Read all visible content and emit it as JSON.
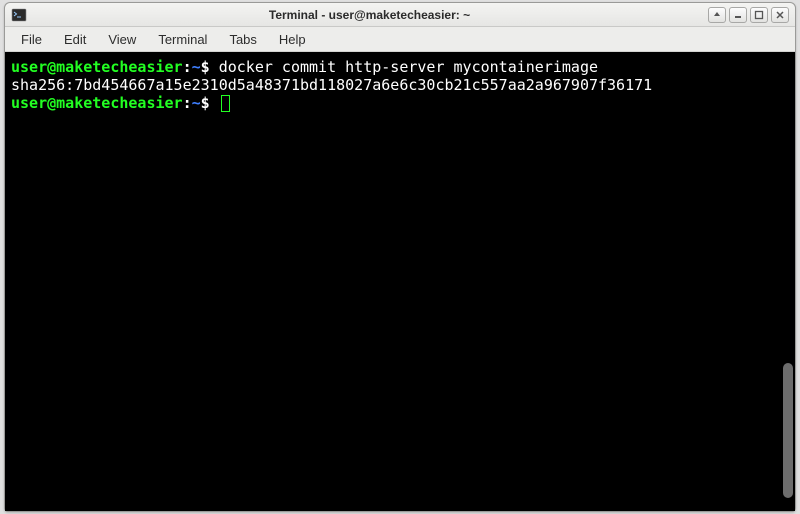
{
  "window": {
    "title": "Terminal - user@maketecheasier: ~"
  },
  "menubar": {
    "items": [
      "File",
      "Edit",
      "View",
      "Terminal",
      "Tabs",
      "Help"
    ]
  },
  "terminal": {
    "lines": [
      {
        "prompt": {
          "userhost": "user@maketecheasier",
          "sep": ":",
          "path": "~",
          "symbol": "$"
        },
        "command": "docker commit http-server mycontainerimage"
      },
      {
        "output": "sha256:7bd454667a15e2310d5a48371bd118027a6e6c30cb21c557aa2a967907f36171"
      },
      {
        "prompt": {
          "userhost": "user@maketecheasier",
          "sep": ":",
          "path": "~",
          "symbol": "$"
        },
        "cursor": true
      }
    ]
  },
  "colors": {
    "prompt_user": "#22ff22",
    "prompt_path": "#3f7fff",
    "terminal_bg": "#000000",
    "terminal_fg": "#ffffff"
  }
}
